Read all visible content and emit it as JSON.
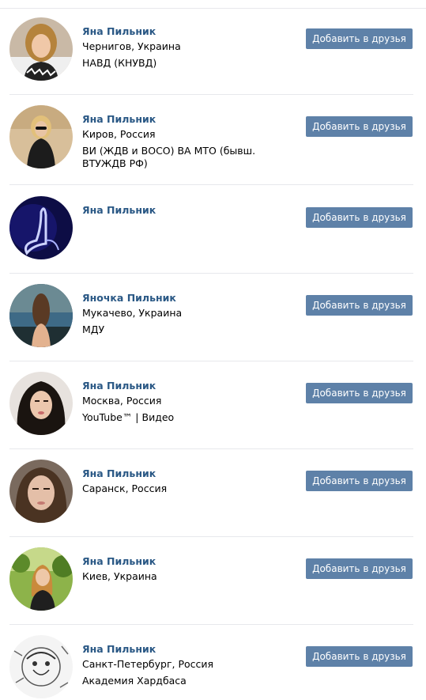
{
  "add_button_label": "Добавить в друзья",
  "colors": {
    "name_link": "#2a5885",
    "button_bg": "#5e81a8",
    "divider": "#e7e8ec"
  },
  "people": [
    {
      "name": "Яна Пильник",
      "location": "Чернигов, Украина",
      "extra": "НАВД (КНУВД)"
    },
    {
      "name": "Яна Пильник",
      "location": "Киров, Россия",
      "extra": "ВИ (ЖДВ и ВОСО) ВА МТО (бывш. ВТУЖДВ РФ)"
    },
    {
      "name": "Яна Пильник",
      "location": "",
      "extra": ""
    },
    {
      "name": "Яночка Пильник",
      "location": "Мукачево, Украина",
      "extra": "МДУ"
    },
    {
      "name": "Яна Пильник",
      "location": "Москва, Россия",
      "extra": "YouTube™ | Видео"
    },
    {
      "name": "Яна Пильник",
      "location": "Саранск, Россия",
      "extra": ""
    },
    {
      "name": "Яна Пильник",
      "location": "Киев, Украина",
      "extra": ""
    },
    {
      "name": "Яна Пильник",
      "location": "Санкт-Петербург, Россия",
      "extra": "Академия Хардбаса"
    }
  ]
}
